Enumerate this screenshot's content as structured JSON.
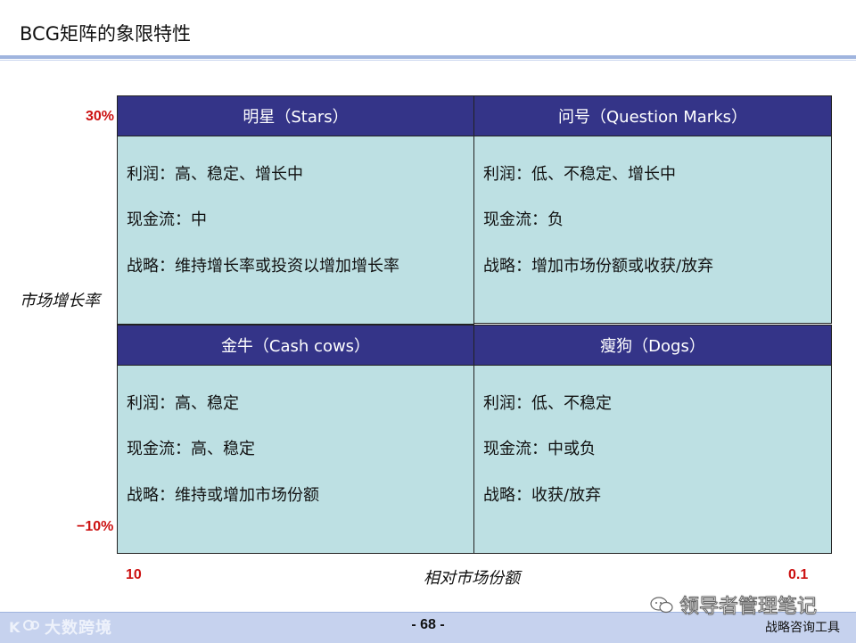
{
  "title": "BCG矩阵的象限特性",
  "axes": {
    "y_top": "30%",
    "y_bottom": "−10%",
    "y_label": "市场增长率",
    "x_left": "10",
    "x_right": "0.1",
    "x_label": "相对市场份额"
  },
  "quadrants": {
    "top_left": {
      "header": "明星（Stars）",
      "profit": "利润：高、稳定、增长中",
      "cashflow": "现金流：中",
      "strategy": "战略：维持增长率或投资以增加增长率"
    },
    "top_right": {
      "header": "问号（Question Marks）",
      "profit": "利润：低、不稳定、增长中",
      "cashflow": "现金流：负",
      "strategy": "战略：增加市场份额或收获/放弃"
    },
    "bottom_left": {
      "header": "金牛（Cash cows）",
      "profit": "利润：高、稳定",
      "cashflow": "现金流：高、稳定",
      "strategy": "战略：维持或增加市场份额"
    },
    "bottom_right": {
      "header": "瘦狗（Dogs）",
      "profit": "利润：低、不稳定",
      "cashflow": "现金流：中或负",
      "strategy": "战略：收获/放弃"
    }
  },
  "footer": {
    "page": "- 68 -",
    "right_text": "战略咨询工具",
    "logo_text": "大数跨境",
    "watermark": "领导者管理笔记"
  },
  "colors": {
    "header_bg": "#343488",
    "cell_bg": "#bde0e3",
    "axis_red": "#cc1111",
    "footer_bg": "#c6d2ee"
  }
}
